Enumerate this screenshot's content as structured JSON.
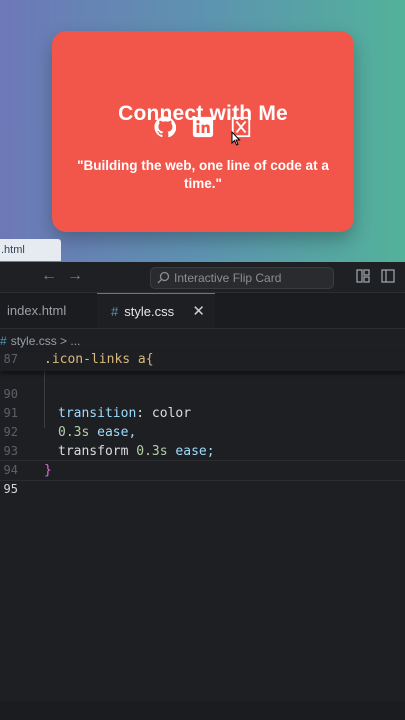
{
  "preview": {
    "card": {
      "title": "Connect with Me",
      "icons": [
        "github-icon",
        "linkedin-icon",
        "twitter-x-icon"
      ],
      "quote": "\"Building the web, one line of code at a time.\""
    },
    "file_pill": ".html",
    "colors": {
      "card": "#f2564b",
      "bg_left": "#6d78b8",
      "bg_right": "#52b29a"
    }
  },
  "editor": {
    "command_center": {
      "label": "Interactive Flip Card"
    },
    "tabs": [
      {
        "label": "index.html"
      },
      {
        "label": "style.css",
        "close": "✕"
      }
    ],
    "breadcrumb": {
      "file": "style.css",
      "trail": "> ..."
    },
    "code": {
      "sticky": {
        "number": "87",
        "text": ".icon-links a{"
      },
      "lines": [
        {
          "number": "90",
          "a": "transition",
          "b": ": color"
        },
        {
          "number": "91",
          "a": "0.3s",
          "b": " ease,"
        },
        {
          "number": "92",
          "a": "transform ",
          "b": "0.3s",
          "c": " ease;"
        },
        {
          "number": "93",
          "text": "}"
        },
        {
          "number": "94",
          "text": ""
        },
        {
          "number": "95",
          "text": ""
        }
      ]
    }
  }
}
